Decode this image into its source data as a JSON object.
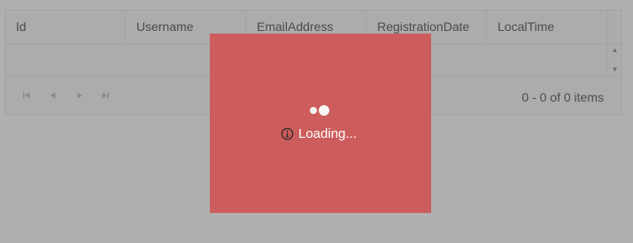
{
  "grid": {
    "columns": [
      "Id",
      "Username",
      "EmailAddress",
      "RegistrationDate",
      "LocalTime"
    ],
    "rows": []
  },
  "pager": {
    "first_icon": "first-page-icon",
    "prev_icon": "prev-page-icon",
    "next_icon": "next-page-icon",
    "last_icon": "last-page-icon",
    "info": "0 - 0 of 0 items"
  },
  "loading": {
    "text": "Loading...",
    "icon": "info-icon",
    "background_color": "#cd5c5c"
  }
}
